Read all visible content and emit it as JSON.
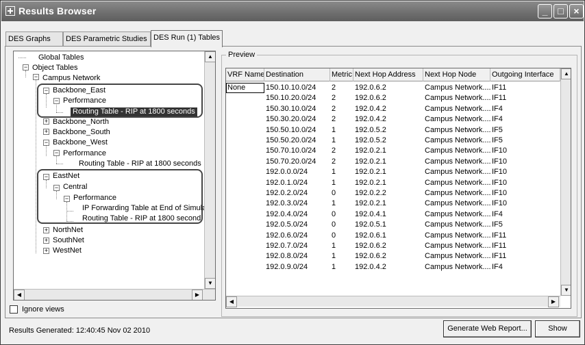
{
  "window": {
    "title": "Results Browser"
  },
  "tabs": [
    {
      "label": "DES Graphs"
    },
    {
      "label": "DES Parametric Studies"
    },
    {
      "label": "DES Run (1) Tables"
    }
  ],
  "tree": {
    "items": [
      {
        "label": "Global Tables"
      },
      {
        "label": "Object Tables"
      },
      {
        "label": "Campus Network"
      },
      {
        "label": "Backbone_East"
      },
      {
        "label": "Performance"
      },
      {
        "label": "Routing Table - RIP at 1800 seconds"
      },
      {
        "label": "Backbone_North"
      },
      {
        "label": "Backbone_South"
      },
      {
        "label": "Backbone_West"
      },
      {
        "label": "Performance"
      },
      {
        "label": "Routing Table - RIP at 1800 seconds"
      },
      {
        "label": "EastNet"
      },
      {
        "label": "Central"
      },
      {
        "label": "Performance"
      },
      {
        "label": "IP Forwarding Table at End of Simula"
      },
      {
        "label": "Routing Table - RIP at 1800 second"
      },
      {
        "label": "NorthNet"
      },
      {
        "label": "SouthNet"
      },
      {
        "label": "WestNet"
      }
    ],
    "ignore_views_label": "Ignore views",
    "ignore_views_checked": false
  },
  "preview": {
    "label": "Preview",
    "columns": [
      "VRF Name",
      "Destination",
      "Metric",
      "Next Hop Address",
      "Next Hop Node",
      "Outgoing Interface"
    ],
    "rows": [
      [
        "None",
        "150.10.10.0/24",
        "2",
        "192.0.6.2",
        "Campus Network....",
        "IF11"
      ],
      [
        "",
        "150.10.20.0/24",
        "2",
        "192.0.6.2",
        "Campus Network....",
        "IF11"
      ],
      [
        "",
        "150.30.10.0/24",
        "2",
        "192.0.4.2",
        "Campus Network....",
        "IF4"
      ],
      [
        "",
        "150.30.20.0/24",
        "2",
        "192.0.4.2",
        "Campus Network....",
        "IF4"
      ],
      [
        "",
        "150.50.10.0/24",
        "1",
        "192.0.5.2",
        "Campus Network....",
        "IF5"
      ],
      [
        "",
        "150.50.20.0/24",
        "1",
        "192.0.5.2",
        "Campus Network....",
        "IF5"
      ],
      [
        "",
        "150.70.10.0/24",
        "2",
        "192.0.2.1",
        "Campus Network....",
        "IF10"
      ],
      [
        "",
        "150.70.20.0/24",
        "2",
        "192.0.2.1",
        "Campus Network....",
        "IF10"
      ],
      [
        "",
        "192.0.0.0/24",
        "1",
        "192.0.2.1",
        "Campus Network....",
        "IF10"
      ],
      [
        "",
        "192.0.1.0/24",
        "1",
        "192.0.2.1",
        "Campus Network....",
        "IF10"
      ],
      [
        "",
        "192.0.2.0/24",
        "0",
        "192.0.2.2",
        "Campus Network....",
        "IF10"
      ],
      [
        "",
        "192.0.3.0/24",
        "1",
        "192.0.2.1",
        "Campus Network....",
        "IF10"
      ],
      [
        "",
        "192.0.4.0/24",
        "0",
        "192.0.4.1",
        "Campus Network....",
        "IF4"
      ],
      [
        "",
        "192.0.5.0/24",
        "0",
        "192.0.5.1",
        "Campus Network....",
        "IF5"
      ],
      [
        "",
        "192.0.6.0/24",
        "0",
        "192.0.6.1",
        "Campus Network....",
        "IF11"
      ],
      [
        "",
        "192.0.7.0/24",
        "1",
        "192.0.6.2",
        "Campus Network....",
        "IF11"
      ],
      [
        "",
        "192.0.8.0/24",
        "1",
        "192.0.6.2",
        "Campus Network....",
        "IF11"
      ],
      [
        "",
        "192.0.9.0/24",
        "1",
        "192.0.4.2",
        "Campus Network....",
        "IF4"
      ]
    ]
  },
  "status": {
    "text": "Results Generated: 12:40:45 Nov 02 2010"
  },
  "buttons": {
    "generate": "Generate Web Report...",
    "show": "Show"
  }
}
